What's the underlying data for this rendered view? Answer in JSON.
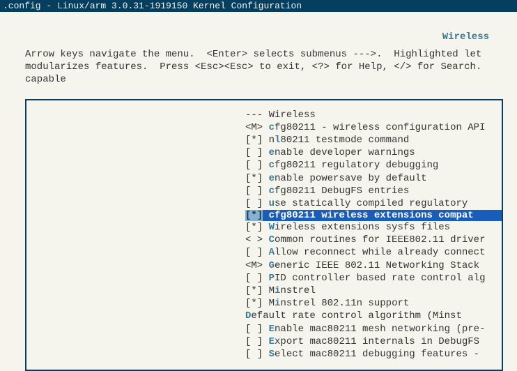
{
  "title": {
    "prefix": ".config - ",
    "hl": "L",
    "rest": "inux/arm 3.0.31-1919150 Kernel Configuration"
  },
  "section_label": "Wireless",
  "help": "Arrow keys navigate the menu.  <Enter> selects submenus --->.  Highlighted let\nmodularizes features.  Press <Esc><Esc> to exit, <?> for Help, </> for Search.\ncapable",
  "header": {
    "prefix": "---",
    "label": "Wireless"
  },
  "items": [
    {
      "prefix": "<M>",
      "indent": "  ",
      "hotkey": "c",
      "text": "fg80211 - wireless configuration API"
    },
    {
      "prefix": "[*]",
      "indent": "    ",
      "hotkey": "",
      "pre": "n",
      "hkmid": "l",
      "text": "80211 testmode command"
    },
    {
      "prefix": "[ ]",
      "indent": "    ",
      "hotkey": "e",
      "text": "nable developer warnings"
    },
    {
      "prefix": "[ ]",
      "indent": "    ",
      "hotkey": "c",
      "text": "fg80211 regulatory debugging"
    },
    {
      "prefix": "[*]",
      "indent": "    ",
      "hotkey": "e",
      "text": "nable powersave by default"
    },
    {
      "prefix": "[ ]",
      "indent": "    ",
      "hotkey": "c",
      "text": "fg80211 DebugFS entries"
    },
    {
      "prefix": "[ ]",
      "indent": "    ",
      "hotkey": "u",
      "text": "se statically compiled regulatory "
    }
  ],
  "selected": {
    "prefix": "[*]",
    "indent": "    ",
    "hotkey": "c",
    "text": "fg80211 wireless extensions compat"
  },
  "items2": [
    {
      "prefix": "[*]",
      "indent": "  ",
      "hotkey": "W",
      "text": "ireless extensions sysfs files"
    },
    {
      "prefix": "< >",
      "indent": "  ",
      "hotkey": "C",
      "text": "ommon routines for IEEE802.11 driver"
    },
    {
      "prefix": "[ ]",
      "indent": "  ",
      "hotkey": "A",
      "text": "llow reconnect while already connect"
    },
    {
      "prefix": "<M>",
      "indent": "  ",
      "hotkey": "G",
      "text": "eneric IEEE 802.11 Networking Stack "
    },
    {
      "prefix": "[ ]",
      "indent": "  ",
      "hotkey": "P",
      "text": "ID controller based rate control alg"
    },
    {
      "prefix": "[*]",
      "indent": "  ",
      "hotkey": "",
      "pre": "M",
      "hkmid": "i",
      "text": "nstrel"
    },
    {
      "prefix": "[*]",
      "indent": "    ",
      "hotkey": "",
      "pre": "M",
      "hkmid": "i",
      "text": "nstrel 802.11n support"
    },
    {
      "prefix": "   ",
      "indent": "  ",
      "hotkey": "D",
      "text": "efault rate control algorithm (Minst"
    },
    {
      "prefix": "[ ]",
      "indent": "  ",
      "hotkey": "E",
      "text": "nable mac80211 mesh networking (pre-"
    },
    {
      "prefix": "[ ]",
      "indent": "  ",
      "hotkey": "E",
      "text": "xport mac80211 internals in DebugFS"
    },
    {
      "prefix": "[ ]",
      "indent": "  ",
      "hotkey": "S",
      "text": "elect mac80211 debugging features  -"
    }
  ]
}
